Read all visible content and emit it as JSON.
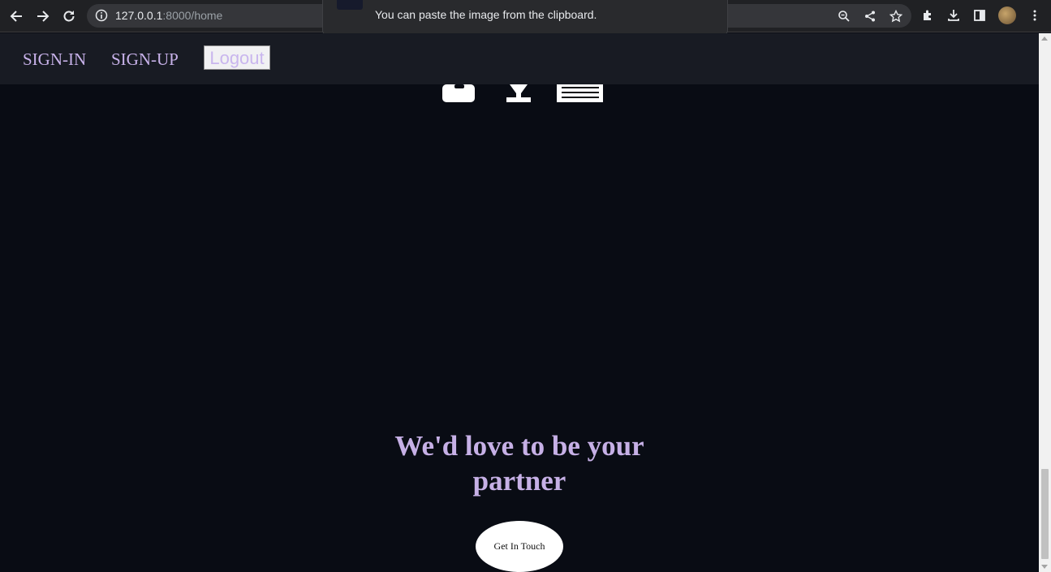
{
  "browser": {
    "url_host": "127.0.0.1",
    "url_path": ":8000/home"
  },
  "notification": {
    "message": "You can paste the image from the clipboard."
  },
  "header": {
    "signin_label": "SIGN-IN",
    "signup_label": "SIGN-UP",
    "logout_label": "Logout"
  },
  "main": {
    "tagline": "We'd love to be your partner",
    "cta_label": "Get In Touch"
  },
  "colors": {
    "page_bg": "#090c14",
    "header_bg": "#181b23",
    "accent_lavender": "#c6b0e6"
  },
  "icons": [
    "back-icon",
    "forward-icon",
    "reload-icon",
    "info-icon",
    "zoom-icon",
    "share-icon",
    "star-icon",
    "extensions-icon",
    "download-icon",
    "sidepanel-icon",
    "menu-icon"
  ]
}
